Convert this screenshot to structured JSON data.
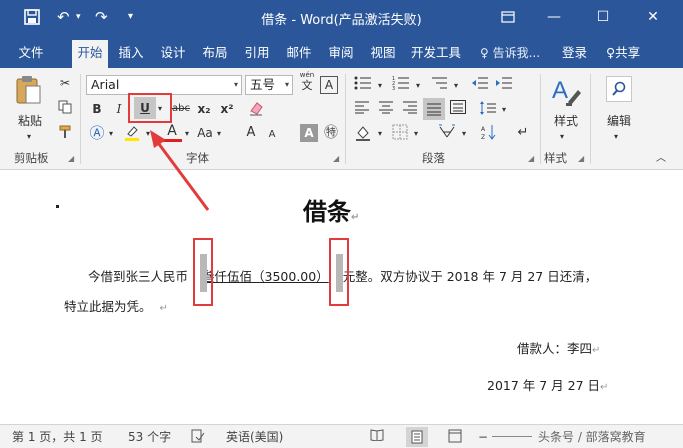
{
  "window": {
    "title": "借条 - Word(产品激活失败)",
    "quick_access": {
      "save": "save-icon",
      "undo": "↶",
      "redo": "↷",
      "customize": "▾"
    }
  },
  "tabs": [
    {
      "label": "文件"
    },
    {
      "label": "开始"
    },
    {
      "label": "插入"
    },
    {
      "label": "设计"
    },
    {
      "label": "布局"
    },
    {
      "label": "引用"
    },
    {
      "label": "邮件"
    },
    {
      "label": "审阅"
    },
    {
      "label": "视图"
    },
    {
      "label": "开发工具"
    }
  ],
  "tell_me": "♀ 告诉我...",
  "login": "登录",
  "share": "♀共享",
  "ribbon": {
    "clipboard": {
      "paste": "粘贴",
      "group": "剪贴板"
    },
    "font": {
      "name": "Arial",
      "size": "五号",
      "wen": "wén",
      "wen_char": "文",
      "box_a": "A",
      "bold": "B",
      "italic": "I",
      "underline": "U",
      "strike": "abc",
      "sub": "x₂",
      "sup": "x²",
      "aa": "Aa",
      "grow": "A",
      "shrink": "A",
      "group": "字体"
    },
    "paragraph": {
      "group": "段落"
    },
    "styles": {
      "label": "样式",
      "group": "样式"
    },
    "editing": {
      "label": "编辑"
    }
  },
  "document": {
    "title": "借条",
    "line1_pre": "今借到张三人民币",
    "line1_amount": "叁仟伍佰（3500.00）",
    "line1_post": "元整。双方协议于 2018 年 7 月 27 日还清，",
    "line2": "特立此据为凭。",
    "signer": "借款人：李四",
    "date": "2017 年 7 月 27 日",
    "para_mark": "↵"
  },
  "status": {
    "page": "第 1 页，共 1 页",
    "words": "53 个字",
    "lang": "英语(美国)",
    "watermark": "头条号 / 部落窝教育"
  },
  "colors": {
    "accent": "#2b579a",
    "annotation": "#e23b3b"
  }
}
